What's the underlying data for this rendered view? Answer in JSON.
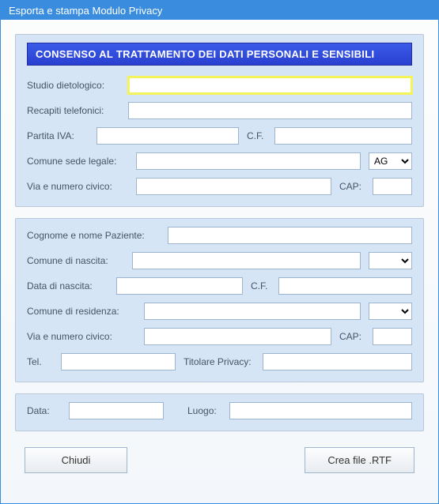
{
  "window": {
    "title": "Esporta e stampa Modulo Privacy"
  },
  "header": {
    "title": "CONSENSO AL TRATTAMENTO DEI DATI PERSONALI E SENSIBILI"
  },
  "studio": {
    "nome_label": "Studio dietologico:",
    "nome_value": "",
    "recapiti_label": "Recapiti telefonici:",
    "recapiti_value": "",
    "piva_label": "Partita IVA:",
    "piva_value": "",
    "cf_label": "C.F.",
    "cf_value": "",
    "comune_sede_label": "Comune sede legale:",
    "comune_sede_value": "",
    "prov_sede_value": "AG",
    "via_label": "Via e numero civico:",
    "via_value": "",
    "cap_label": "CAP:",
    "cap_value": ""
  },
  "paziente": {
    "nome_label": "Cognome e nome Paziente:",
    "nome_value": "",
    "comune_nascita_label": "Comune di nascita:",
    "comune_nascita_value": "",
    "prov_nascita_value": "",
    "data_nascita_label": "Data di nascita:",
    "data_nascita_value": "",
    "cf_label": "C.F.",
    "cf_value": "",
    "comune_res_label": "Comune di residenza:",
    "comune_res_value": "",
    "prov_res_value": "",
    "via_label": "Via e numero civico:",
    "via_value": "",
    "cap_label": "CAP:",
    "cap_value": "",
    "tel_label": "Tel.",
    "tel_value": "",
    "titolare_label": "Titolare Privacy:",
    "titolare_value": ""
  },
  "footer_panel": {
    "data_label": "Data:",
    "data_value": "",
    "luogo_label": "Luogo:",
    "luogo_value": ""
  },
  "buttons": {
    "close": "Chiudi",
    "create": "Crea file .RTF"
  }
}
